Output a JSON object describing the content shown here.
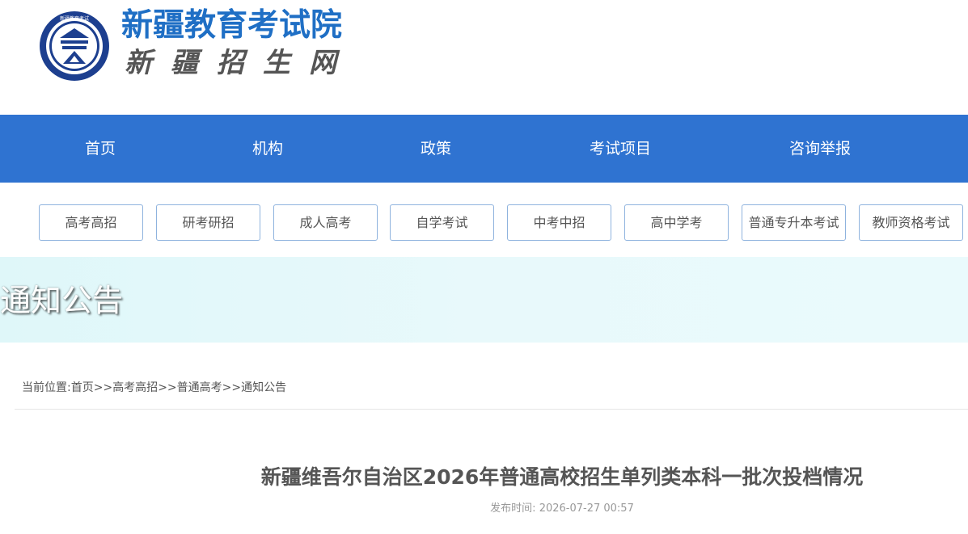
{
  "header": {
    "site_title": "新疆教育考试院",
    "site_subtitle": "新疆招生网",
    "emblem_text": "新疆教育考试"
  },
  "nav": {
    "items": [
      {
        "label": "首页"
      },
      {
        "label": "机构"
      },
      {
        "label": "政策"
      },
      {
        "label": "考试项目"
      },
      {
        "label": "咨询举报"
      }
    ]
  },
  "categories": [
    {
      "label": "高考高招"
    },
    {
      "label": "研考研招"
    },
    {
      "label": "成人高考"
    },
    {
      "label": "自学考试"
    },
    {
      "label": "中考中招"
    },
    {
      "label": "高中学考"
    },
    {
      "label": "普通专升本考试"
    },
    {
      "label": "教师资格考试"
    }
  ],
  "banner": {
    "title": "通知公告"
  },
  "breadcrumb": {
    "prefix": "当前位置:",
    "items": [
      "首页",
      "高考高招",
      "普通高考",
      "通知公告"
    ],
    "separator": ">>"
  },
  "article": {
    "title": "新疆维吾尔自治区2026年普通高校招生单列类本科一批次投档情况",
    "publish_label": "发布时间:",
    "publish_time": "2026-07-27 00:57"
  },
  "colors": {
    "brand_blue": "#1f6fc5",
    "nav_blue": "#2f73d1",
    "button_border": "#8fb3de",
    "banner_bg": "#dff7f9"
  }
}
